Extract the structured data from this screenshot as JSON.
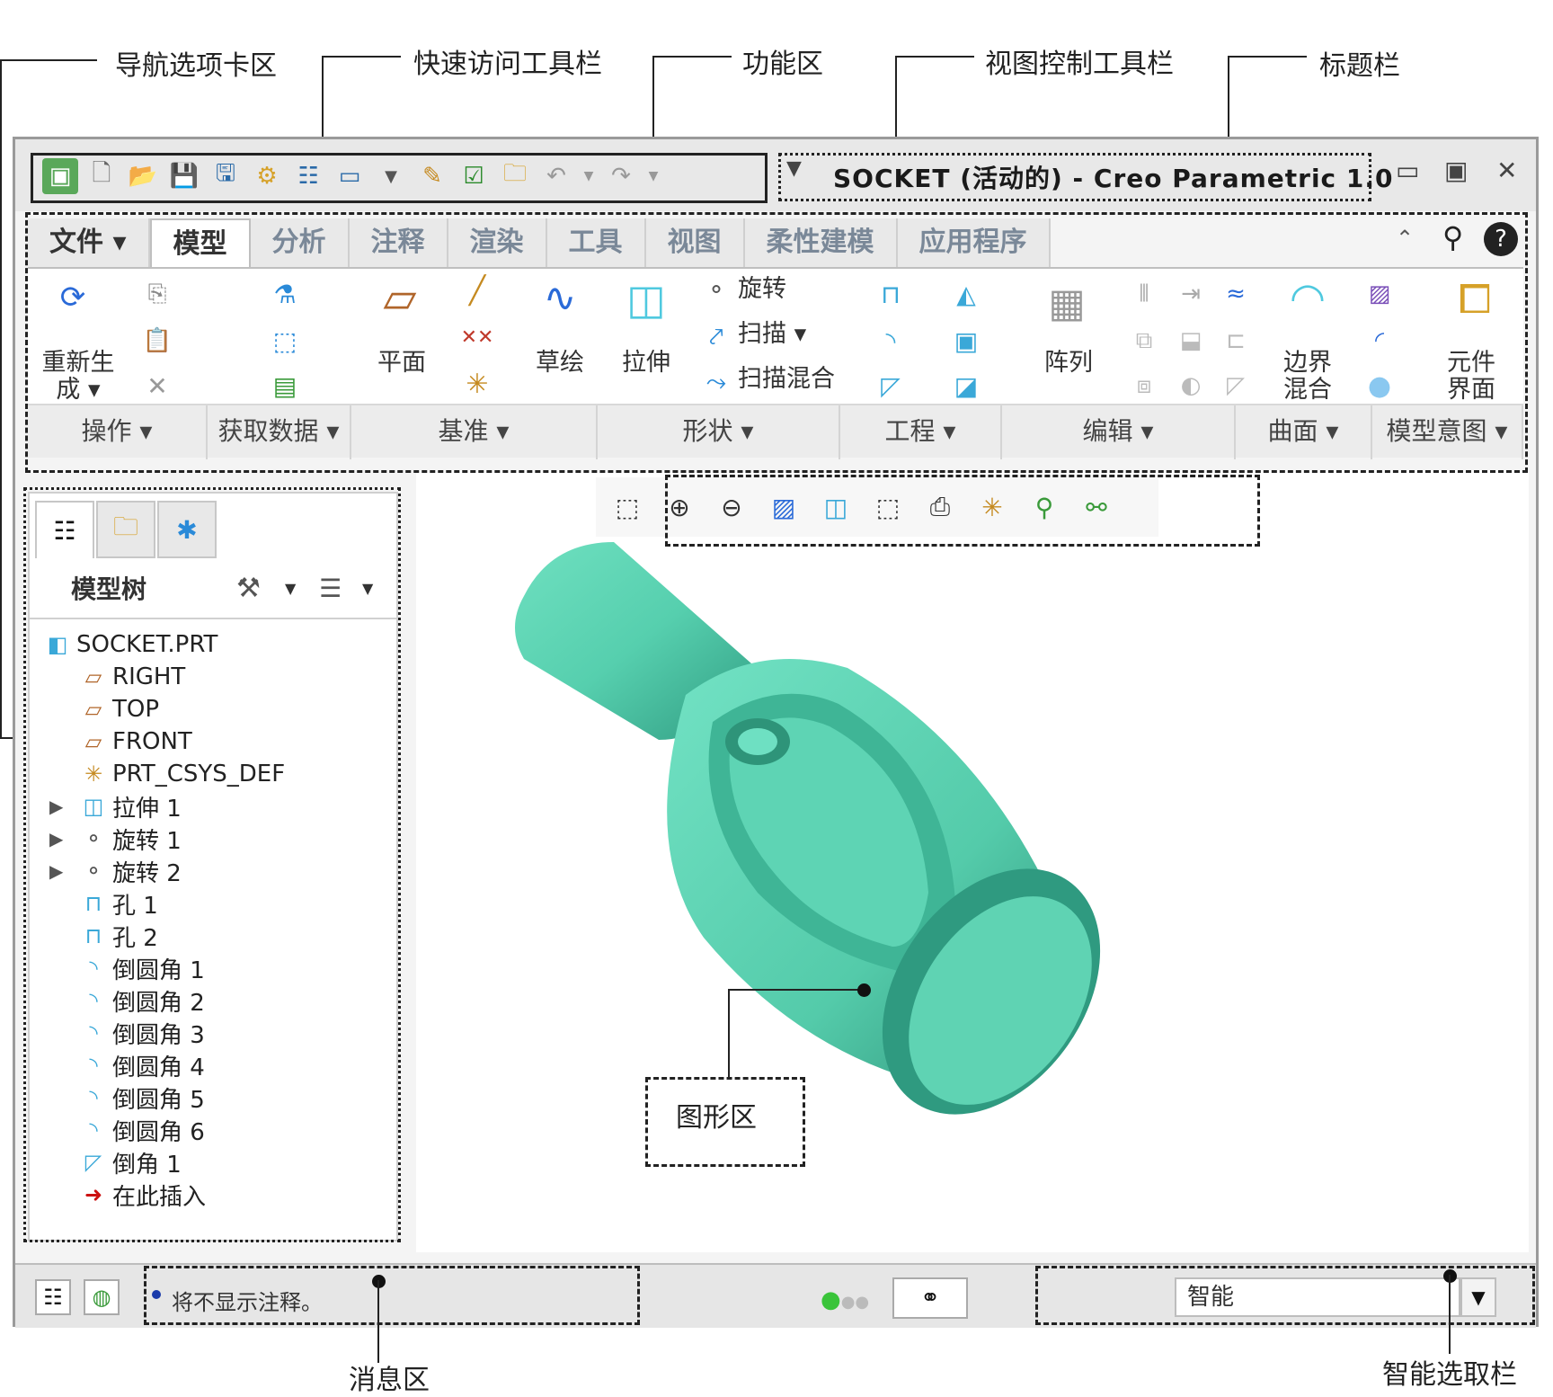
{
  "callouts": {
    "nav_tab_area": "导航选项卡区",
    "quick_access": "快速访问工具栏",
    "ribbon": "功能区",
    "view_control": "视图控制工具栏",
    "title_bar": "标题栏",
    "graphics_area": "图形区",
    "message_area": "消息区",
    "smart_select": "智能选取栏"
  },
  "window": {
    "title": "SOCKET (活动的) - Creo Parametric 1.0",
    "min_icon": "minimize-icon",
    "max_icon": "maximize-icon",
    "close_icon": "close-icon"
  },
  "tabs": [
    "文件 ▾",
    "模型",
    "分析",
    "注释",
    "渲染",
    "工具",
    "视图",
    "柔性建模",
    "应用程序"
  ],
  "ribbon": {
    "buttons": {
      "regenerate": "重新生成 ▾",
      "plane": "平面",
      "sketch": "草绘",
      "extrude": "拉伸",
      "revolve": "旋转",
      "sweep": "扫描 ▾",
      "swept_blend": "扫描混合",
      "pattern": "阵列",
      "boundary_blend": "边界混合",
      "component_interface": "元件界面"
    },
    "groups": [
      "操作 ▾",
      "获取数据 ▾",
      "基准 ▾",
      "形状 ▾",
      "工程 ▾",
      "编辑 ▾",
      "曲面 ▾",
      "模型意图 ▾"
    ]
  },
  "nav": {
    "header": "模型树",
    "tree": [
      {
        "label": "SOCKET.PRT",
        "icon": "part-icon"
      },
      {
        "label": "RIGHT",
        "icon": "datum-plane-icon"
      },
      {
        "label": "TOP",
        "icon": "datum-plane-icon"
      },
      {
        "label": "FRONT",
        "icon": "datum-plane-icon"
      },
      {
        "label": "PRT_CSYS_DEF",
        "icon": "csys-icon"
      },
      {
        "label": "拉伸 1",
        "icon": "extrude-icon"
      },
      {
        "label": "旋转 1",
        "icon": "revolve-icon"
      },
      {
        "label": "旋转 2",
        "icon": "revolve-icon"
      },
      {
        "label": "孔 1",
        "icon": "hole-icon"
      },
      {
        "label": "孔 2",
        "icon": "hole-icon"
      },
      {
        "label": "倒圆角 1",
        "icon": "round-icon"
      },
      {
        "label": "倒圆角 2",
        "icon": "round-icon"
      },
      {
        "label": "倒圆角 3",
        "icon": "round-icon"
      },
      {
        "label": "倒圆角 4",
        "icon": "round-icon"
      },
      {
        "label": "倒圆角 5",
        "icon": "round-icon"
      },
      {
        "label": "倒圆角 6",
        "icon": "round-icon"
      },
      {
        "label": "倒角 1",
        "icon": "chamfer-icon"
      },
      {
        "label": "在此插入",
        "icon": "insert-here-icon"
      }
    ]
  },
  "status": {
    "message": "将不显示注释。",
    "smart_filter": "智能"
  },
  "colors": {
    "model": "#56cfae",
    "model_dark": "#2f9a80",
    "insert_arrow": "#cc1111",
    "datum": "#b0652a"
  }
}
